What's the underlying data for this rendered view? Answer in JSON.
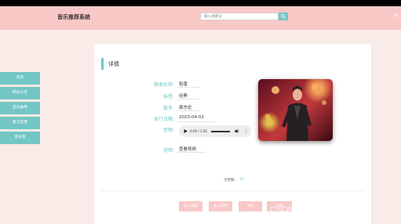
{
  "header": {
    "site_title": "音乐推荐系统",
    "search_placeholder": "输入关键词"
  },
  "sidebar": {
    "items": [
      {
        "label": "首页"
      },
      {
        "label": "网站公告"
      },
      {
        "label": "音乐推荐"
      },
      {
        "label": "留言反馈"
      },
      {
        "label": "音乐库"
      }
    ]
  },
  "detail": {
    "title": "详情",
    "fields": {
      "song_name": {
        "label": "歌曲名称:",
        "value": "稻香"
      },
      "tag": {
        "label": "标签:",
        "value": "经典"
      },
      "singer": {
        "label": "歌手:",
        "value": "周杰伦"
      },
      "release_date": {
        "label": "发行日期:",
        "value": "2023-04-01"
      },
      "audio": {
        "label": "音频:",
        "time": "0:00 / 1:16",
        "progress": 0
      },
      "video": {
        "label": "视频:",
        "value": "查看视频"
      }
    },
    "clicks_label": "点赞数:",
    "clicks_value": "10"
  },
  "actions": {
    "buttons": [
      {
        "label": "加入收藏"
      },
      {
        "label": "加入购物"
      },
      {
        "label": "评论"
      },
      {
        "label": "点赞"
      }
    ]
  },
  "watermark": "CSDN @vx_BS81330",
  "colors": {
    "header_bg": "#f8c8c7",
    "accent": "#72c6c4",
    "page_bg": "#f9ebe7",
    "button": "#f8c8c7"
  }
}
